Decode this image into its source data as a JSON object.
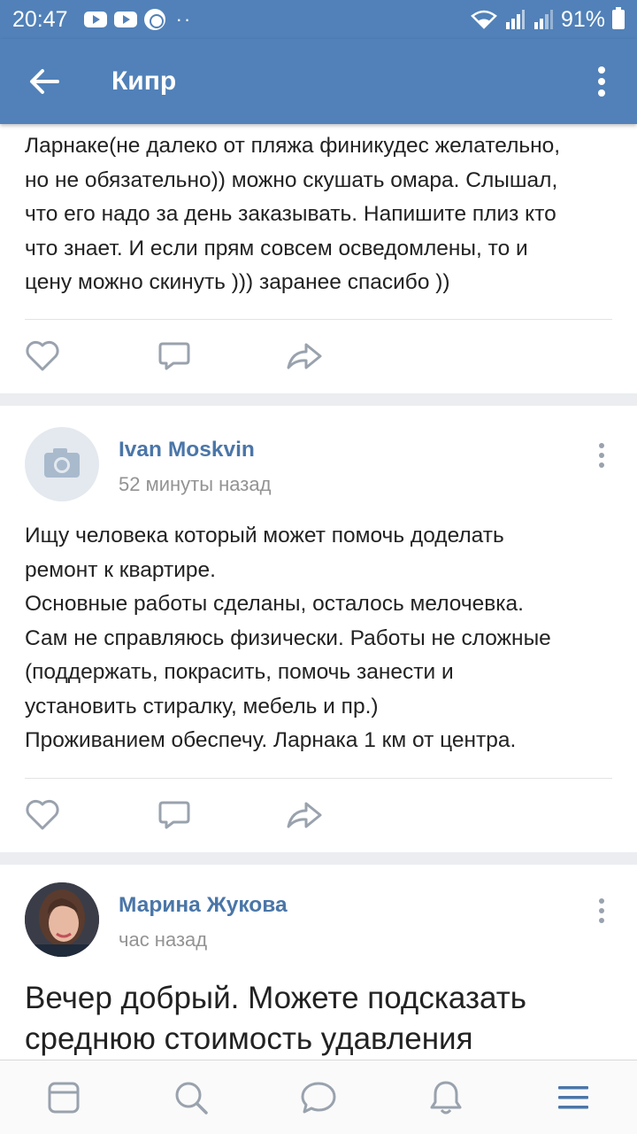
{
  "status_bar": {
    "time": "20:47",
    "dots": "··",
    "battery": "91%"
  },
  "toolbar": {
    "title": "Кипр"
  },
  "posts": [
    {
      "text_fragment": "Ларнаке(не далеко от пляжа финикудес желательно,\nно не обязательно)) можно скушать омара. Слышал,\nчто его надо за день заказывать. Напишите плиз кто\nчто знает. И если прям совсем осведомлены, то и\nцену можно скинуть ))) заранее спасибо ))"
    },
    {
      "author": "Ivan Moskvin",
      "time": "52 минуты назад",
      "text": "Ищу человека который может помочь доделать\nремонт к квартире.\nОсновные работы сделаны, осталось мелочевка.\nСам не справляюсь физически. Работы не сложные\n(поддержать, покрасить, помочь занести и\nустановить стиралку, мебель и пр.)\nПроживанием обеспечу. Ларнака 1 км от центра."
    },
    {
      "author": "Марина Жукова",
      "time": "час назад",
      "text": "Вечер добрый. Можете подсказать\nсреднюю стоимость удавления"
    }
  ],
  "icons": {
    "like": "heart-icon",
    "comment": "comment-icon",
    "share": "share-icon",
    "nav": [
      "news-icon",
      "search-icon",
      "messages-icon",
      "notifications-icon",
      "menu-icon"
    ]
  },
  "colors": {
    "accent": "#5181b8",
    "author": "#4a76a8",
    "icon": "#99a2ad",
    "nav_active": "#4a76a8",
    "nav_inactive": "#99a2ad"
  }
}
